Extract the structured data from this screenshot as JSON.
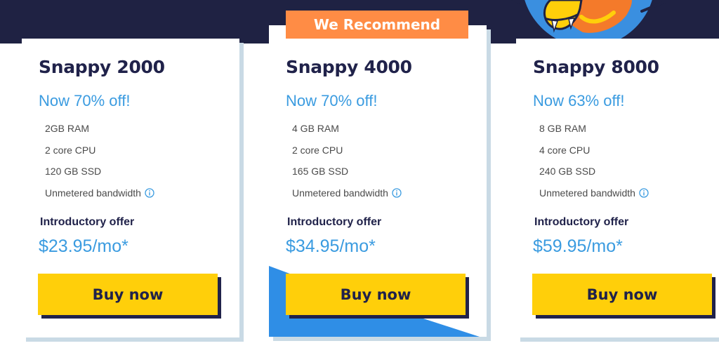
{
  "badge": {
    "label": "We Recommend"
  },
  "plans": [
    {
      "name": "Snappy 2000",
      "discount": "Now 70% off!",
      "features": [
        "2GB RAM",
        "2 core CPU",
        "120 GB SSD",
        "Unmetered bandwidth"
      ],
      "offer_label": "Introductory offer",
      "price": "$23.95/mo*",
      "button_label": "Buy now"
    },
    {
      "name": "Snappy 4000",
      "discount": "Now 70% off!",
      "features": [
        "4 GB RAM",
        "2 core CPU",
        "165 GB SSD",
        "Unmetered bandwidth"
      ],
      "offer_label": "Introductory offer",
      "price": "$34.95/mo*",
      "button_label": "Buy now"
    },
    {
      "name": "Snappy 8000",
      "discount": "Now 63% off!",
      "features": [
        "8 GB RAM",
        "4 core CPU",
        "240 GB SSD",
        "Unmetered bandwidth"
      ],
      "offer_label": "Introductory offer",
      "price": "$59.95/mo*",
      "button_label": "Buy now"
    }
  ],
  "icons": {
    "info": "info-icon",
    "mascot": "snake-mascot-icon"
  },
  "colors": {
    "navy": "#1f2243",
    "accent_blue": "#3a9be0",
    "button_yellow": "#ffcf0a",
    "badge_orange": "#ff8c45",
    "card_shadow": "#c9dae5"
  }
}
